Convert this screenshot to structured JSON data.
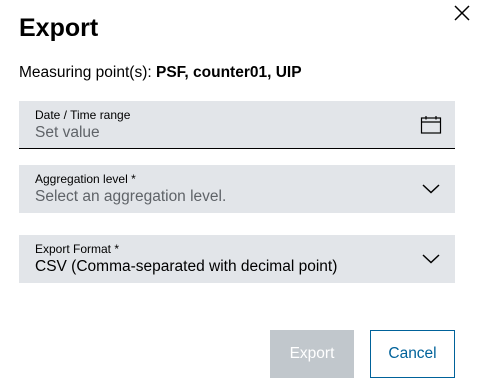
{
  "dialog": {
    "title": "Export",
    "measuring_points_label": "Measuring point(s):",
    "measuring_points_value": "PSF, counter01, UIP"
  },
  "fields": {
    "date_range": {
      "label": "Date / Time range",
      "placeholder": "Set value",
      "icon": "calendar-icon"
    },
    "aggregation": {
      "label": "Aggregation level *",
      "placeholder": "Select an aggregation level.",
      "icon": "chevron-down-icon"
    },
    "export_format": {
      "label": "Export Format *",
      "value": "CSV (Comma-separated with decimal point)",
      "icon": "chevron-down-icon"
    }
  },
  "buttons": {
    "export_label": "Export",
    "cancel_label": "Cancel"
  },
  "colors": {
    "field_bg": "#e2e5e9",
    "accent": "#00629a",
    "disabled_bg": "#c1c7cc"
  }
}
